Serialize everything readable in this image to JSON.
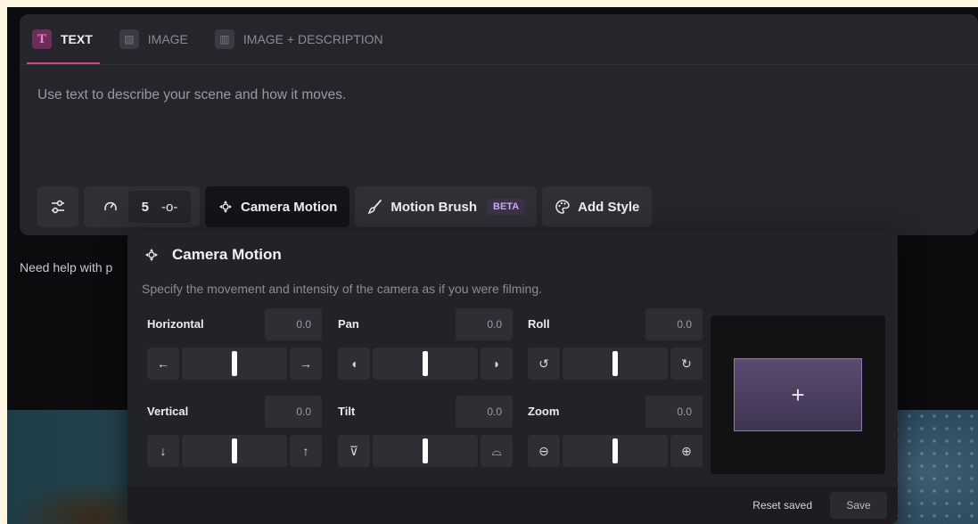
{
  "tabs": [
    {
      "label": "TEXT",
      "icon": "text-icon",
      "glyph": "T",
      "active": true
    },
    {
      "label": "IMAGE",
      "icon": "image-icon",
      "glyph": "▨",
      "active": false
    },
    {
      "label": "IMAGE + DESCRIPTION",
      "icon": "image-description-icon",
      "glyph": "▥",
      "active": false
    }
  ],
  "prompt": {
    "placeholder": "Use text to describe your scene and how it moves."
  },
  "toolbar": {
    "settings_icon": "sliders-icon",
    "speed_icon": "gauge-icon",
    "duration_value": "5",
    "camera_motion_label": "Camera Motion",
    "motion_brush_label": "Motion Brush",
    "motion_brush_badge": "BETA",
    "add_style_label": "Add Style"
  },
  "help_text": "Need help with p",
  "camera_motion": {
    "title": "Camera Motion",
    "description": "Specify the movement and intensity of the camera as if you were filming.",
    "controls": [
      {
        "key": "horizontal",
        "label": "Horizontal",
        "value": "0.0",
        "left_glyph": "←",
        "right_glyph": "→",
        "left_icon": "arrow-left-icon",
        "right_icon": "arrow-right-icon",
        "level": 0.5
      },
      {
        "key": "pan",
        "label": "Pan",
        "value": "0.0",
        "left_glyph": "◖",
        "right_glyph": "◗",
        "left_icon": "pan-left-icon",
        "right_icon": "pan-right-icon",
        "level": 0.5
      },
      {
        "key": "roll",
        "label": "Roll",
        "value": "0.0",
        "left_glyph": "↺",
        "right_glyph": "↻",
        "left_icon": "roll-left-icon",
        "right_icon": "roll-right-icon",
        "level": 0.5
      },
      {
        "key": "vertical",
        "label": "Vertical",
        "value": "0.0",
        "left_glyph": "↓",
        "right_glyph": "↑",
        "left_icon": "arrow-down-icon",
        "right_icon": "arrow-up-icon",
        "level": 0.5
      },
      {
        "key": "tilt",
        "label": "Tilt",
        "value": "0.0",
        "left_glyph": "⊽",
        "right_glyph": "⌓",
        "left_icon": "tilt-down-icon",
        "right_icon": "tilt-up-icon",
        "level": 0.5
      },
      {
        "key": "zoom",
        "label": "Zoom",
        "value": "0.0",
        "left_glyph": "⊖",
        "right_glyph": "⊕",
        "left_icon": "zoom-out-icon",
        "right_icon": "zoom-in-icon",
        "level": 0.5
      }
    ],
    "preview_add_glyph": "+",
    "reset_label": "Reset saved",
    "save_label": "Save"
  }
}
